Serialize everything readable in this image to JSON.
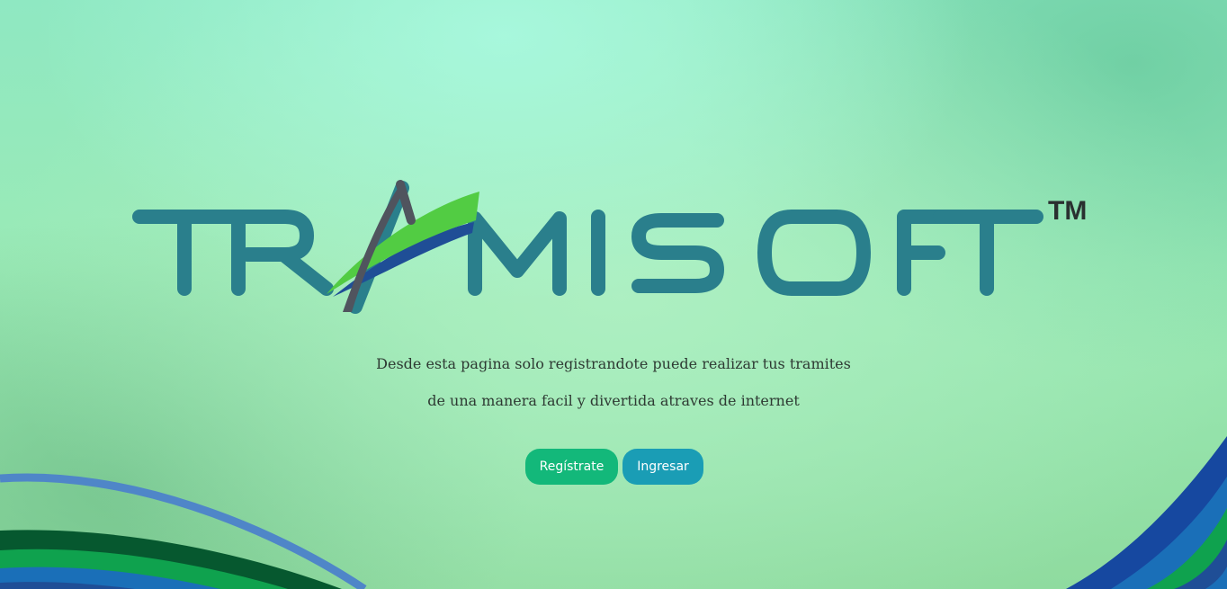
{
  "brand": {
    "name": "TRAMISOFT",
    "trademark": "TM",
    "color_text": "#2a7f8c",
    "color_accent_green": "#52cc43",
    "color_accent_blue": "#1f4e96",
    "color_accent_gray": "#50545e"
  },
  "hero": {
    "line1": "Desde esta pagina solo registrandote puede realizar tus tramites",
    "line2": "de una manera facil y divertida atraves de internet"
  },
  "actions": {
    "register_label": "Regístrate",
    "login_label": "Ingresar"
  },
  "colors": {
    "register_button": "#13b87a",
    "login_button": "#1a9db5"
  }
}
